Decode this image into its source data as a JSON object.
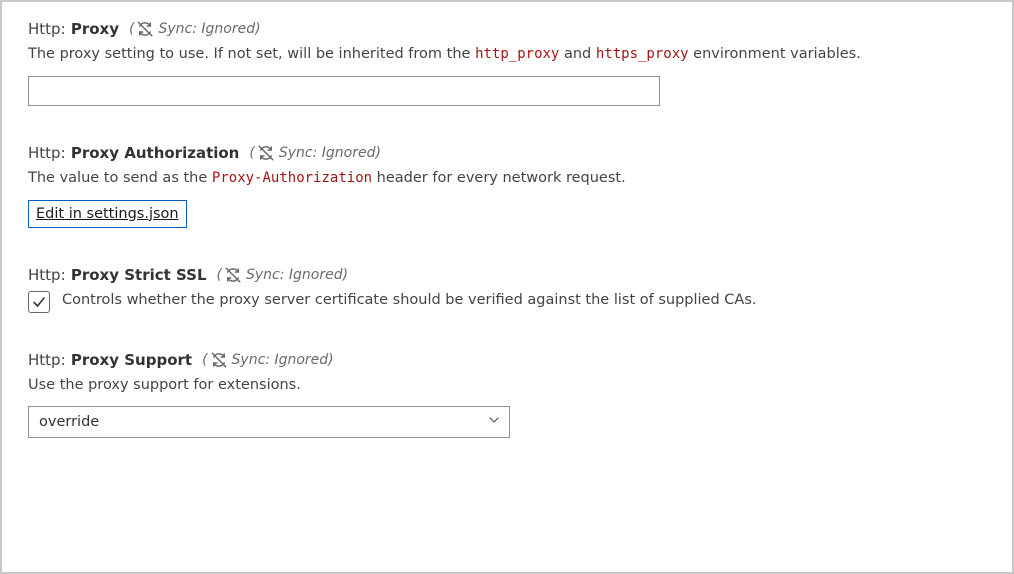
{
  "sync_label": "Sync: Ignored",
  "settings": {
    "proxy": {
      "category": "Http:",
      "name": "Proxy",
      "desc_pre": "The proxy setting to use. If not set, will be inherited from the ",
      "code1": "http_proxy",
      "desc_mid": " and ",
      "code2": "https_proxy",
      "desc_post": " environment variables.",
      "value": ""
    },
    "proxyAuth": {
      "category": "Http:",
      "name": "Proxy Authorization",
      "desc_pre": "The value to send as the ",
      "code1": "Proxy-Authorization",
      "desc_post": " header for every network request.",
      "edit_link": "Edit in settings.json"
    },
    "proxyStrictSSL": {
      "category": "Http:",
      "name": "Proxy Strict SSL",
      "desc": "Controls whether the proxy server certificate should be verified against the list of supplied CAs.",
      "checked": true
    },
    "proxySupport": {
      "category": "Http:",
      "name": "Proxy Support",
      "desc": "Use the proxy support for extensions.",
      "value": "override"
    }
  }
}
